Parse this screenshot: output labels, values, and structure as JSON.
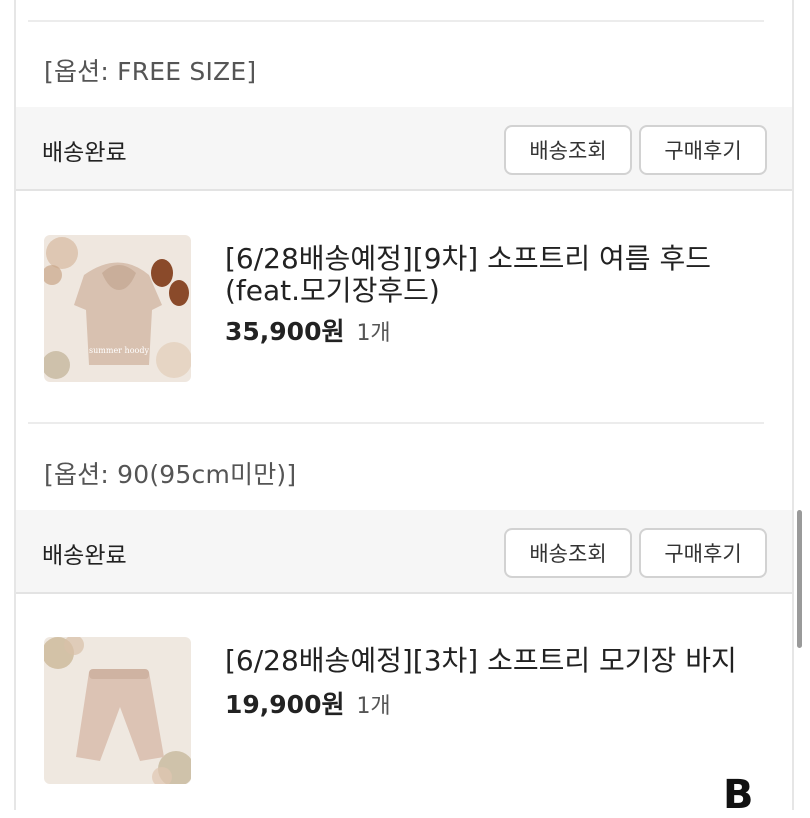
{
  "orders": [
    {
      "option_text": "[옵션: FREE SIZE]"
    }
  ],
  "items": [
    {
      "status": "배송완료",
      "track_label": "배송조회",
      "review_label": "구매후기",
      "title_line1": "[6/28배송예정][9차] 소프트리 여름 후드",
      "title_line2": "(feat.모기장후드)",
      "price": "35,900원",
      "qty": "1개",
      "thumb_caption": "summer hoody",
      "option_text": "[옵션: 90(95cm미만)]"
    },
    {
      "status": "배송완료",
      "track_label": "배송조회",
      "review_label": "구매후기",
      "title_line1": "[6/28배송예정][3차] 소프트리 모기장 바지",
      "price": "19,900원",
      "qty": "1개"
    }
  ],
  "brand_mark": "B",
  "colors": {
    "status_bar_bg": "#f6f6f6",
    "border": "#d2d2d2"
  }
}
